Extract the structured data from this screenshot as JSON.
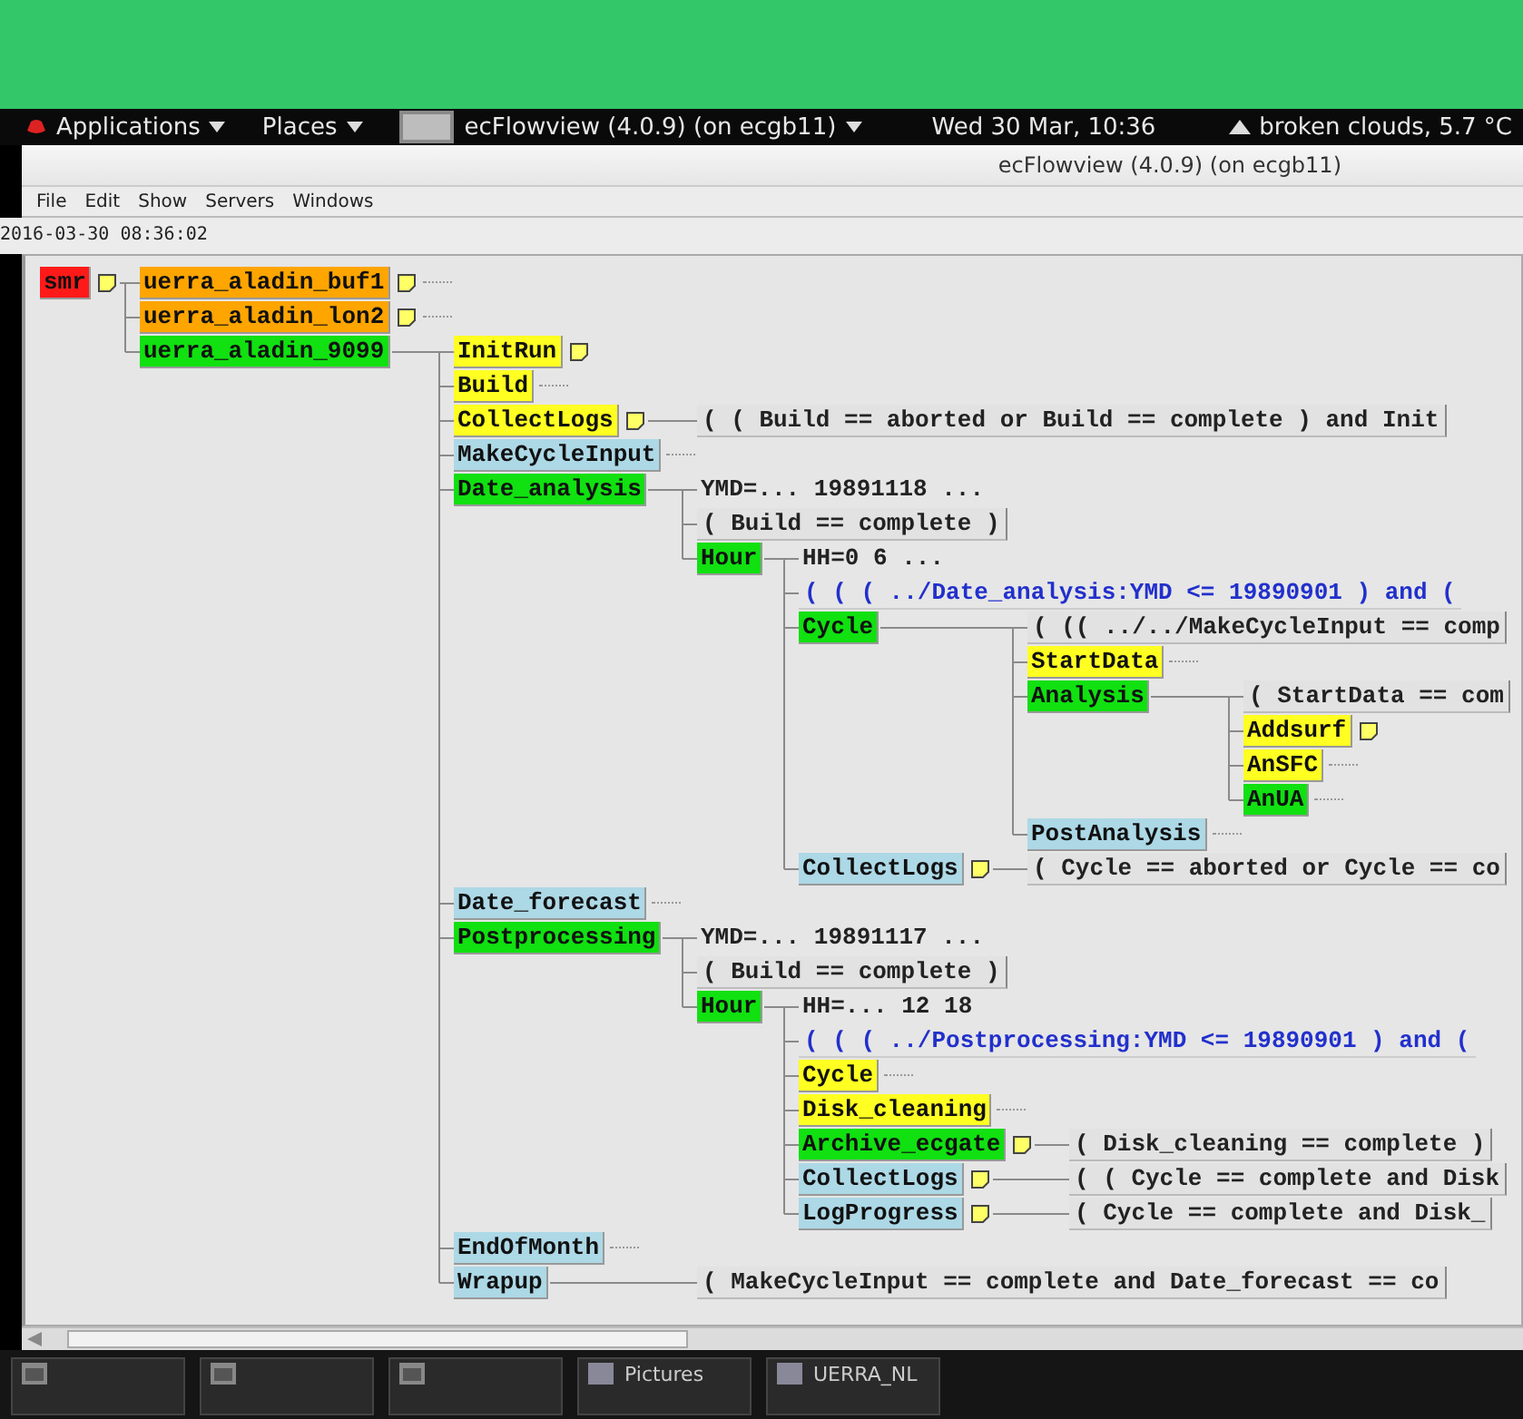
{
  "top_panel": {
    "applications": "Applications",
    "places": "Places",
    "window_button": "ecFlowview (4.0.9) (on ecgb11)",
    "clock": "Wed 30 Mar, 10:36",
    "weather": "broken clouds, 5.7 °C"
  },
  "window": {
    "title": "ecFlowview (4.0.9) (on ecgb11)"
  },
  "menu": [
    "File",
    "Edit",
    "Show",
    "Servers",
    "Windows"
  ],
  "timestamp": "2016-03-30 08:36:02",
  "tree": [
    {
      "kind": "node",
      "name": "smr",
      "color": "#ff1a1a",
      "note": true,
      "collapsed": false,
      "children": [
        {
          "kind": "node",
          "name": "uerra_aladin_buf1",
          "color": "#ffa500",
          "note": true,
          "collapsed": true
        },
        {
          "kind": "node",
          "name": "uerra_aladin_lon2",
          "color": "#ffa500",
          "note": true,
          "collapsed": true
        },
        {
          "kind": "node",
          "name": "uerra_aladin_9099",
          "color": "#11e011",
          "note": false,
          "collapsed": false,
          "children": [
            {
              "kind": "node",
              "name": "InitRun",
              "color": "#ffff22",
              "note": true,
              "collapsed": false
            },
            {
              "kind": "node",
              "name": "Build",
              "color": "#ffff22",
              "note": false,
              "collapsed": true
            },
            {
              "kind": "node",
              "name": "CollectLogs",
              "color": "#ffff22",
              "note": true,
              "collapsed": false,
              "children": [
                {
                  "kind": "trigger",
                  "text": "( ( Build == aborted or Build == complete ) and Init"
                }
              ]
            },
            {
              "kind": "node",
              "name": "MakeCycleInput",
              "color": "#add8e6",
              "note": false,
              "collapsed": true
            },
            {
              "kind": "node",
              "name": "Date_analysis",
              "color": "#11e011",
              "note": false,
              "collapsed": false,
              "children": [
                {
                  "kind": "variable",
                  "text": "YMD=... 19891118 ..."
                },
                {
                  "kind": "trigger",
                  "text": "( Build == complete )"
                },
                {
                  "kind": "node",
                  "name": "Hour",
                  "color": "#11e011",
                  "note": false,
                  "collapsed": false,
                  "children": [
                    {
                      "kind": "variable",
                      "text": "HH=0 6 ..."
                    },
                    {
                      "kind": "complete",
                      "text": "( ( ( ../Date_analysis:YMD <= 19890901 ) and ("
                    },
                    {
                      "kind": "node",
                      "name": "Cycle",
                      "color": "#11e011",
                      "note": false,
                      "collapsed": false,
                      "children": [
                        {
                          "kind": "trigger",
                          "text": "( (( ../../MakeCycleInput == comp"
                        },
                        {
                          "kind": "node",
                          "name": "StartData",
                          "color": "#ffff22",
                          "note": false,
                          "collapsed": true
                        },
                        {
                          "kind": "node",
                          "name": "Analysis",
                          "color": "#11e011",
                          "note": false,
                          "collapsed": false,
                          "children": [
                            {
                              "kind": "trigger",
                              "text": "( StartData == com"
                            },
                            {
                              "kind": "node",
                              "name": "Addsurf",
                              "color": "#ffff22",
                              "note": true,
                              "collapsed": false
                            },
                            {
                              "kind": "node",
                              "name": "AnSFC",
                              "color": "#ffff22",
                              "note": false,
                              "collapsed": true
                            },
                            {
                              "kind": "node",
                              "name": "AnUA",
                              "color": "#11e011",
                              "note": false,
                              "collapsed": true
                            }
                          ]
                        },
                        {
                          "kind": "node",
                          "name": "PostAnalysis",
                          "color": "#add8e6",
                          "note": false,
                          "collapsed": true
                        }
                      ]
                    },
                    {
                      "kind": "node",
                      "name": "CollectLogs",
                      "color": "#add8e6",
                      "note": true,
                      "collapsed": false,
                      "children": [
                        {
                          "kind": "trigger",
                          "text": "( Cycle == aborted or Cycle == co"
                        }
                      ]
                    }
                  ]
                }
              ]
            },
            {
              "kind": "node",
              "name": "Date_forecast",
              "color": "#add8e6",
              "note": false,
              "collapsed": true
            },
            {
              "kind": "node",
              "name": "Postprocessing",
              "color": "#11e011",
              "note": false,
              "collapsed": false,
              "children": [
                {
                  "kind": "variable",
                  "text": "YMD=... 19891117 ..."
                },
                {
                  "kind": "trigger",
                  "text": "( Build == complete )"
                },
                {
                  "kind": "node",
                  "name": "Hour",
                  "color": "#11e011",
                  "note": false,
                  "collapsed": false,
                  "children": [
                    {
                      "kind": "variable",
                      "text": "HH=... 12 18"
                    },
                    {
                      "kind": "complete",
                      "text": "( ( ( ../Postprocessing:YMD <= 19890901 ) and ("
                    },
                    {
                      "kind": "node",
                      "name": "Cycle",
                      "color": "#ffff22",
                      "note": false,
                      "collapsed": true
                    },
                    {
                      "kind": "node",
                      "name": "Disk_cleaning",
                      "color": "#ffff22",
                      "note": false,
                      "collapsed": true
                    },
                    {
                      "kind": "node",
                      "name": "Archive_ecgate",
                      "color": "#11e011",
                      "note": true,
                      "collapsed": false,
                      "children": [
                        {
                          "kind": "trigger",
                          "text": "( Disk_cleaning == complete )"
                        }
                      ]
                    },
                    {
                      "kind": "node",
                      "name": "CollectLogs",
                      "color": "#add8e6",
                      "note": true,
                      "collapsed": false,
                      "children": [
                        {
                          "kind": "trigger",
                          "text": "( ( Cycle == complete and Disk"
                        }
                      ]
                    },
                    {
                      "kind": "node",
                      "name": "LogProgress",
                      "color": "#add8e6",
                      "note": true,
                      "collapsed": false,
                      "children": [
                        {
                          "kind": "trigger",
                          "text": "( Cycle == complete and Disk_"
                        }
                      ]
                    }
                  ]
                }
              ]
            },
            {
              "kind": "node",
              "name": "EndOfMonth",
              "color": "#add8e6",
              "note": false,
              "collapsed": true
            },
            {
              "kind": "node",
              "name": "Wrapup",
              "color": "#add8e6",
              "note": false,
              "collapsed": false,
              "children": [
                {
                  "kind": "trigger",
                  "text": "( MakeCycleInput == complete and Date_forecast == co"
                }
              ]
            }
          ]
        }
      ]
    }
  ],
  "taskbar": [
    "Pictures",
    "UERRA_NL"
  ]
}
